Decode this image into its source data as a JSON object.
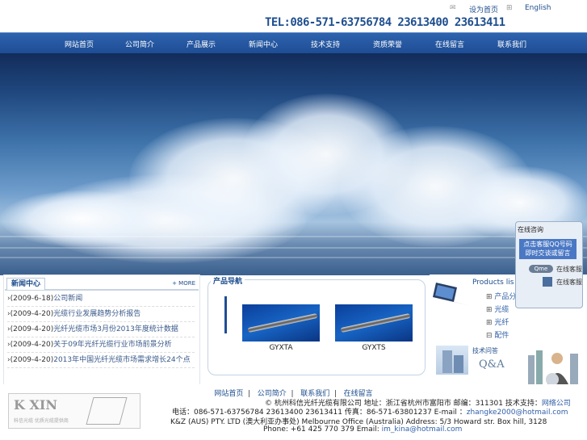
{
  "header": {
    "home_label": "设为首页",
    "english_label": "English",
    "tel": "TEL:086-571-63756784 23613400 23613411"
  },
  "nav": [
    "网站首页",
    "公司简介",
    "产品展示",
    "新闻中心",
    "技术支持",
    "资质荣誉",
    "在线留言",
    "联系我们"
  ],
  "news": {
    "title": "新闻中心",
    "more": "+ MORE",
    "items": [
      {
        "date": "(2009-6-18)",
        "text": "公司新闻"
      },
      {
        "date": "(2009-4-20)",
        "text": "光缆行业发展趋势分析报告"
      },
      {
        "date": "(2009-4-20)",
        "text": "光纤光缆市场3月份2013年度统计数据"
      },
      {
        "date": "(2009-4-20)",
        "text": "关于09年光纤光缆行业市场前景分析"
      },
      {
        "date": "(2009-4-20)",
        "text": "2013年中国光纤光缆市场需求增长24个点"
      }
    ]
  },
  "products": {
    "title": "产品导航",
    "items": [
      {
        "label": "GYXTA"
      },
      {
        "label": "GYXTS"
      }
    ]
  },
  "sidebar": {
    "products_list": "Products lis",
    "tree": [
      "产品分类",
      "光缆",
      "光纤",
      "配件"
    ],
    "faq_title": "技术问答",
    "qa": "Q&A"
  },
  "online": {
    "title": "在线咨询",
    "qq_text1": "点击客服QQ号码",
    "qq_text2": "即时交谈或留言",
    "service1": "在线客服",
    "service2": "在线客服"
  },
  "footer": {
    "links": [
      "网站首页",
      "公司简介",
      "联系我们",
      "在线留言"
    ],
    "line1_prefix": "© ",
    "line1": "杭州科信光纤光缆有限公司 地址：浙江省杭州市富阳市 邮编：311301 技术支持：",
    "line1_link": "网络公司",
    "line2_prefix": "电话：086-571-63756784 23613400 23613411 传真：86-571-63801237 E-mail ：",
    "line2_email": "zhangke2000@hotmail.com",
    "line3": "K&Z (AUS) PTY. LTD (澳大利亚办事处) Melbourne Office (Australia) Address: 5/3 Howard str. Box hill, 3128",
    "line4_prefix": "Phone: +61 425 770 379 Email: ",
    "line4_email": "im_kina@hotmail.com",
    "logo_text": "K  XIN",
    "logo_sub": "科信光缆 优质光缆提供商"
  },
  "colors": {
    "nav_bg": "#1e4d95",
    "link": "#2f5fa8",
    "tel": "#1f4f8f"
  }
}
